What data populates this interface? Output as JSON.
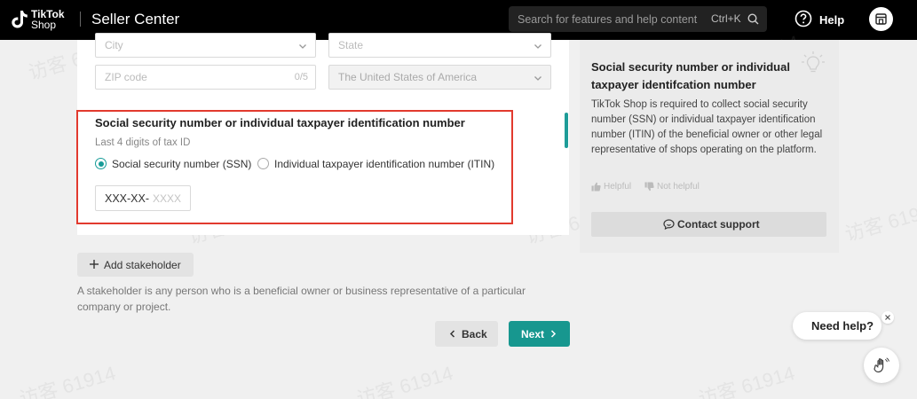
{
  "header": {
    "logo_line1": "TikTok",
    "logo_line2": "Shop",
    "title": "Seller Center",
    "search_placeholder": "Search for features and help content",
    "search_shortcut": "Ctrl+K",
    "help_label": "Help"
  },
  "address": {
    "city_placeholder": "City",
    "state_placeholder": "State",
    "zip_placeholder": "ZIP code",
    "zip_counter": "0/5",
    "country_value": "The United States of America"
  },
  "tax": {
    "title": "Social security number or individual taxpayer identification number",
    "subtitle": "Last 4 digits of tax ID",
    "options": [
      {
        "label": "Social security number (SSN)",
        "selected": true
      },
      {
        "label": "Individual taxpayer identification number (ITIN)",
        "selected": false
      }
    ],
    "prefix": "XXX-XX-",
    "placeholder": "XXXX"
  },
  "stakeholder": {
    "add_label": "Add stakeholder",
    "note": "A stakeholder is any person who is a beneficial owner or business representative of a particular company or project."
  },
  "nav": {
    "back_label": "Back",
    "next_label": "Next"
  },
  "help_card": {
    "title": "Social security number or individual taxpayer identifcation number",
    "body": "TikTok Shop is required to collect social security number (SSN) or individual taxpayer identification number (ITIN) of the beneficial owner or other legal representative of shops operating on the platform.",
    "helpful_label": "Helpful",
    "not_helpful_label": "Not helpful",
    "contact_label": "Contact support"
  },
  "widget": {
    "need_help_label": "Need help?"
  },
  "watermark_text": "访客 61914",
  "colors": {
    "accent": "#179c98",
    "highlight": "#e23a2e",
    "topbar": "#000000"
  }
}
